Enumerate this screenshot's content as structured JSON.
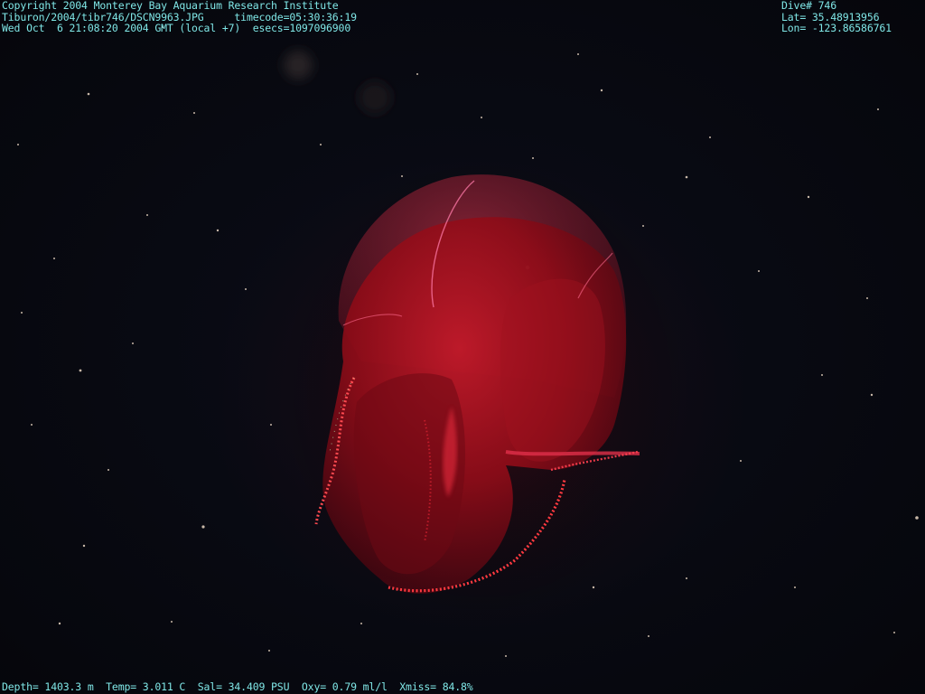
{
  "overlay": {
    "header_left": [
      "Copyright 2004 Monterey Bay Aquarium Research Institute",
      "Tiburon/2004/tibr746/DSCN9963.JPG     timecode=05:30:36:19",
      "Wed Oct  6 21:08:20 2004 GMT (local +7)  esecs=1097096900"
    ],
    "header_right": [
      "Dive# 746",
      "Lat= 35.48913956",
      "Lon= -123.86586761"
    ],
    "footer": "Depth= 1403.3 m  Temp= 3.011 C  Sal= 34.409 PSU  Oxy= 0.79 ml/l  Xmiss= 84.8%"
  },
  "colors": {
    "overlay_text": "#7fe6e6",
    "background": "#05060c",
    "subject": "#c0101a"
  },
  "subject": {
    "description_icon": "ctenophore-icon"
  }
}
